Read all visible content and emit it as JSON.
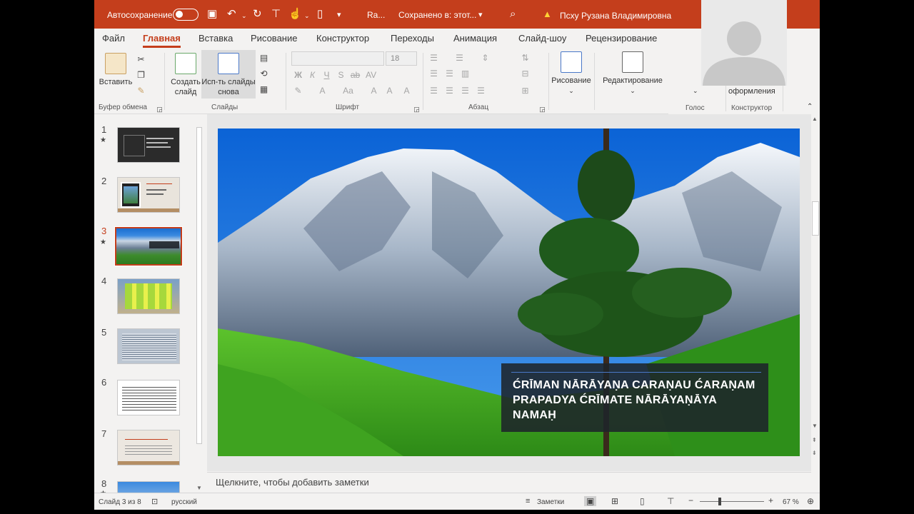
{
  "titlebar": {
    "autosave_label": "Автосохранение",
    "doc_title": "Ra...",
    "saved_status": "Сохранено в: этот...",
    "user_name": "Псху Рузана Владимировна"
  },
  "tabs": [
    "Файл",
    "Главная",
    "Вставка",
    "Рисование",
    "Конструктор",
    "Переходы",
    "Анимация",
    "Слайд-шоу",
    "Рецензирование"
  ],
  "ribbon": {
    "paste_label": "Вставить",
    "clipboard_group": "Буфер обмена",
    "new_slide_label": "Создать слайд",
    "reuse_slides_label": "Исп-ть слайды снова",
    "slides_group": "Слайды",
    "font_size": "18",
    "font_group": "Шрифт",
    "paragraph_group": "Абзац",
    "drawing_label": "Рисование",
    "editing_label": "Редактирование",
    "voice_group": "Голос",
    "design_label": "оформления",
    "designer_group": "Конструктор"
  },
  "thumbnails": [
    {
      "num": "1",
      "star": true
    },
    {
      "num": "2",
      "star": false
    },
    {
      "num": "3",
      "star": true,
      "active": true
    },
    {
      "num": "4",
      "star": false
    },
    {
      "num": "5",
      "star": false
    },
    {
      "num": "6",
      "star": false
    },
    {
      "num": "7",
      "star": false
    },
    {
      "num": "8",
      "star": true
    }
  ],
  "slide": {
    "caption_line1": "ĆRĪMAN NĀRĀYAṆA CARAṆAU ĆARAṆAM",
    "caption_line2": "PRAPADYA ĆRĪMATE NĀRĀYAṆĀYA NAMAḤ"
  },
  "notes_placeholder": "Щелкните, чтобы добавить заметки",
  "status": {
    "slide_counter": "Слайд 3 из 8",
    "language": "русский",
    "notes_label": "Заметки",
    "zoom": "67 %"
  },
  "colors": {
    "accent": "#c43e1c"
  }
}
